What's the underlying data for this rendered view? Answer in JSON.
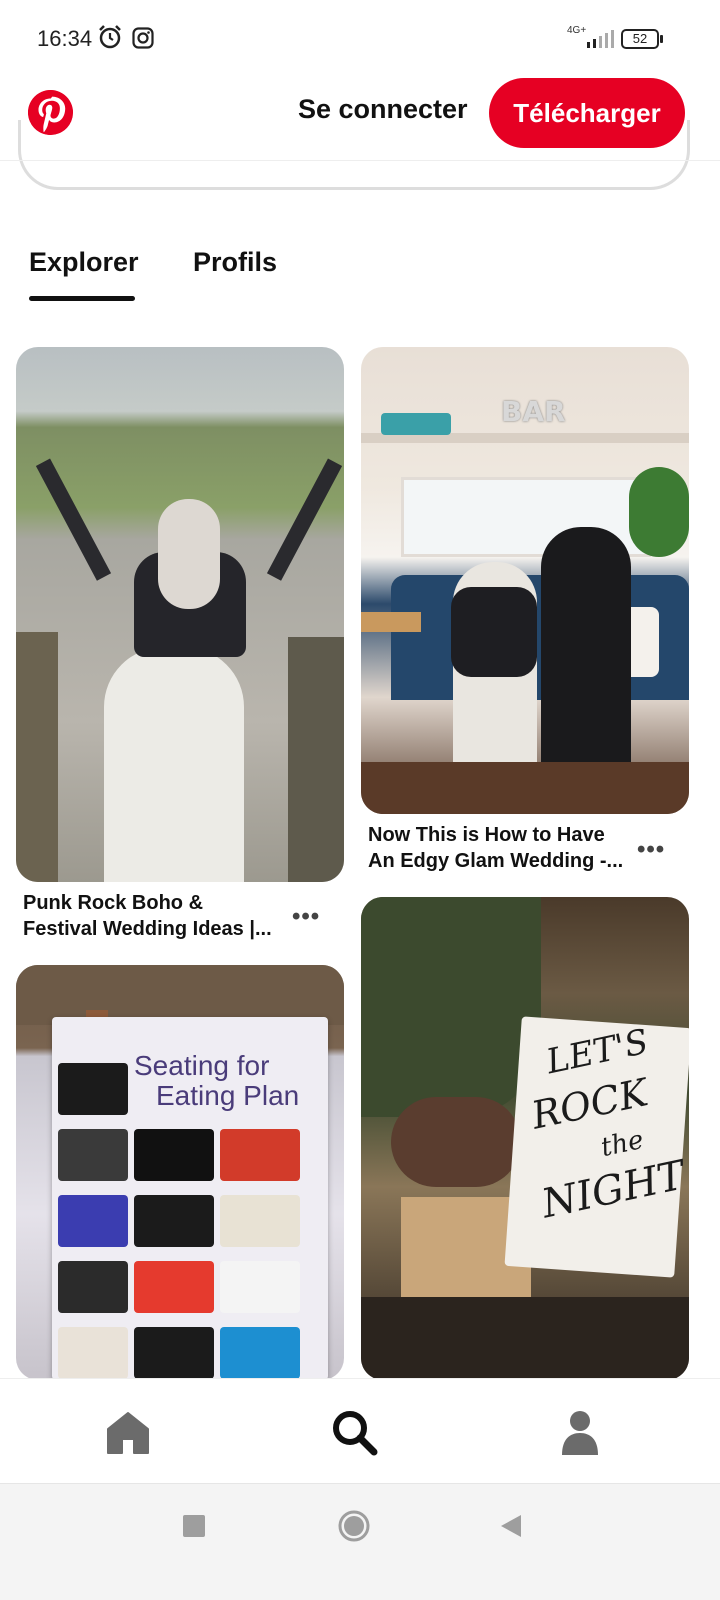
{
  "status_bar": {
    "time": "16:34",
    "network": "4G+",
    "battery": "52"
  },
  "header": {
    "login_label": "Se connecter",
    "download_label": "Télécharger",
    "brand_color": "#e60023"
  },
  "tabs": [
    {
      "label": "Explorer",
      "active": true
    },
    {
      "label": "Profils",
      "active": false
    }
  ],
  "pins": [
    {
      "title": "Punk Rock Boho & Festival Wedding Ideas |...",
      "title_line1": "Punk Rock Boho &",
      "title_line2": "Festival Wedding Ideas |...",
      "more": "•••"
    },
    {
      "title": "Now This is How to Have An Edgy Glam Wedding -...",
      "title_line1": "Now This is How to Have",
      "title_line2": "An Edgy Glam Wedding -...",
      "more": "•••"
    },
    {
      "image_text_line1": "Seating for",
      "image_text_line2": "Eating Plan"
    },
    {
      "image_text_line1": "LET'S",
      "image_text_line2": "ROCK",
      "image_text_line3": "the",
      "image_text_line4": "NIGHT"
    }
  ],
  "pin2_sign": "BAR",
  "bottom_nav": [
    {
      "icon": "home-icon"
    },
    {
      "icon": "search-icon"
    },
    {
      "icon": "profile-icon"
    }
  ],
  "system_nav": [
    {
      "icon": "recent-apps-icon"
    },
    {
      "icon": "home-circle-icon"
    },
    {
      "icon": "back-triangle-icon"
    }
  ]
}
